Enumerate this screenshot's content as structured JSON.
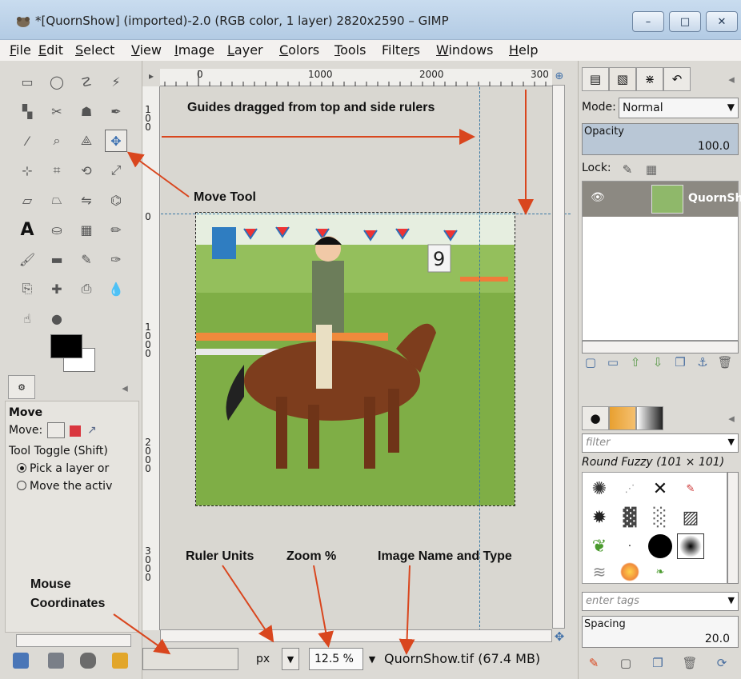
{
  "window": {
    "title": "*[QuornShow] (imported)-2.0 (RGB color, 1 layer) 2820x2590 – GIMP",
    "minimize": "–",
    "maximize": "□",
    "close": "✕"
  },
  "menubar": {
    "items": [
      {
        "u": "F",
        "rest": "ile"
      },
      {
        "u": "E",
        "rest": "dit"
      },
      {
        "u": "S",
        "rest": "elect"
      },
      {
        "u": "V",
        "rest": "iew"
      },
      {
        "u": "I",
        "rest": "mage"
      },
      {
        "u": "L",
        "rest": "ayer"
      },
      {
        "u": "C",
        "rest": "olors"
      },
      {
        "u": "T",
        "rest": "ools"
      },
      {
        "pre": "Filte",
        "u": "r",
        "rest": "s"
      },
      {
        "u": "W",
        "rest": "indows"
      },
      {
        "u": "H",
        "rest": "elp"
      }
    ]
  },
  "toolbox": {
    "tools": [
      "rect-select",
      "ellipse-select",
      "free-select",
      "fuzzy-select",
      "select-by-color",
      "scissors",
      "foreground-select",
      "paths",
      "color-picker",
      "zoom",
      "measure",
      "move",
      "align",
      "crop",
      "rotate",
      "scale",
      "shear",
      "perspective",
      "flip",
      "cage-transform",
      "text",
      "bucket-fill",
      "blend",
      "pencil",
      "paintbrush",
      "eraser",
      "airbrush",
      "ink",
      "clone",
      "heal",
      "perspective-clone",
      "blur",
      "smudge",
      "dodge-burn"
    ],
    "fg_color": "#000000",
    "bg_color": "#ffffff",
    "options_title": "Move",
    "move_label": "Move:",
    "toggle_label": "Tool Toggle  (Shift)",
    "radio_1": "Pick a layer or",
    "radio_2": "Move the activ"
  },
  "rulers": {
    "h_ticks": [
      "0",
      "1000",
      "2000",
      "300"
    ],
    "v_ticks": [
      "0",
      "1000",
      "2000",
      "3000"
    ]
  },
  "statusbar": {
    "unit": "px",
    "zoom": "12.5 %",
    "image_name": "QuornShow.tif (67.4 MB)"
  },
  "annotations": {
    "guides": "Guides dragged from top and side rulers",
    "move_tool": "Move Tool",
    "ruler_units": "Ruler Units",
    "zoom": "Zoom %",
    "image_name": "Image Name and Type",
    "mouse_line1": "Mouse",
    "mouse_line2": "Coordinates"
  },
  "layers": {
    "mode_label": "Mode:",
    "mode_value": "Normal",
    "opacity_label": "Opacity",
    "opacity_value": "100.0",
    "lock_label": "Lock:",
    "layer_name": "QuornSh"
  },
  "brushes": {
    "filter_placeholder": "filter",
    "selected": "Round Fuzzy (101 × 101)",
    "tags_placeholder": "enter tags",
    "spacing_label": "Spacing",
    "spacing_value": "20.0"
  },
  "colors": {
    "guide": "#3777a4",
    "annotation_arrow": "#d9461e",
    "titlebar": "#c9dcef"
  }
}
